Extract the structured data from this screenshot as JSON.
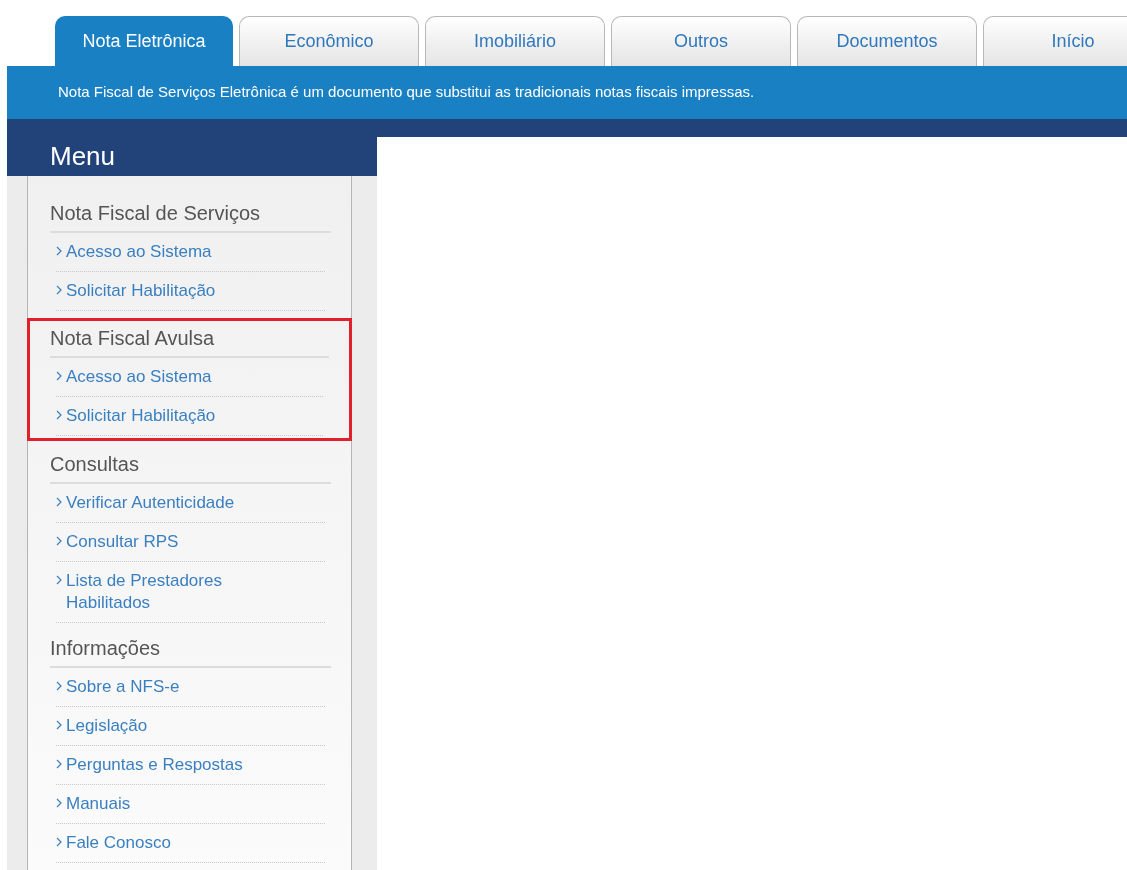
{
  "tabs": [
    {
      "label": "Nota Eletrônica",
      "selected": true
    },
    {
      "label": "Econômico",
      "selected": false
    },
    {
      "label": "Imobiliário",
      "selected": false
    },
    {
      "label": "Outros",
      "selected": false
    },
    {
      "label": "Documentos",
      "selected": false
    },
    {
      "label": "Início",
      "selected": false
    }
  ],
  "banner": "Nota Fiscal de Serviços Eletrônica é um documento que substitui as tradicionais notas fiscais impressas.",
  "menu": {
    "title": "Menu",
    "sections": [
      {
        "heading": "Nota Fiscal de Serviços",
        "highlighted": false,
        "items": [
          "Acesso ao Sistema",
          "Solicitar Habilitação"
        ]
      },
      {
        "heading": "Nota Fiscal Avulsa",
        "highlighted": true,
        "items": [
          "Acesso ao Sistema",
          "Solicitar Habilitação"
        ]
      },
      {
        "heading": "Consultas",
        "highlighted": false,
        "items": [
          "Verificar Autenticidade",
          "Consultar RPS",
          "Lista de Prestadores Habilitados"
        ]
      },
      {
        "heading": "Informações",
        "highlighted": false,
        "items": [
          "Sobre a NFS-e",
          "Legislação",
          "Perguntas e Respostas",
          "Manuais",
          "Fale Conosco"
        ]
      }
    ]
  }
}
